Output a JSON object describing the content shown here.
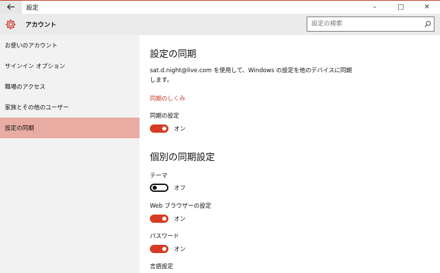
{
  "window": {
    "title": "設定",
    "back_icon": "arrow-left-icon",
    "minimize": "–",
    "maximize": "□",
    "close": "✕"
  },
  "header": {
    "icon": "gear-icon",
    "title": "アカウント",
    "search_placeholder": "設定の検索",
    "accent": "#c63a2a"
  },
  "sidebar": {
    "items": [
      {
        "label": "お使いのアカウント"
      },
      {
        "label": "サインイン オプション"
      },
      {
        "label": "職場のアクセス"
      },
      {
        "label": "家族とその他のユーザー"
      },
      {
        "label": "設定の同期",
        "active": true
      }
    ]
  },
  "main": {
    "heading": "設定の同期",
    "description": "sat.d.night@live.com を使用して、Windows の設定を他のデバイスに同期します。",
    "link": "同期のしくみ",
    "sync_setting": {
      "label": "同期の設定",
      "state": "オン",
      "on": true
    },
    "section_heading": "個別の同期設定",
    "individual": [
      {
        "label": "テーマ",
        "state": "オフ",
        "on": false
      },
      {
        "label": "Web ブラウザーの設定",
        "state": "オン",
        "on": true
      },
      {
        "label": "パスワード",
        "state": "オン",
        "on": true
      },
      {
        "label": "言語設定"
      }
    ]
  }
}
